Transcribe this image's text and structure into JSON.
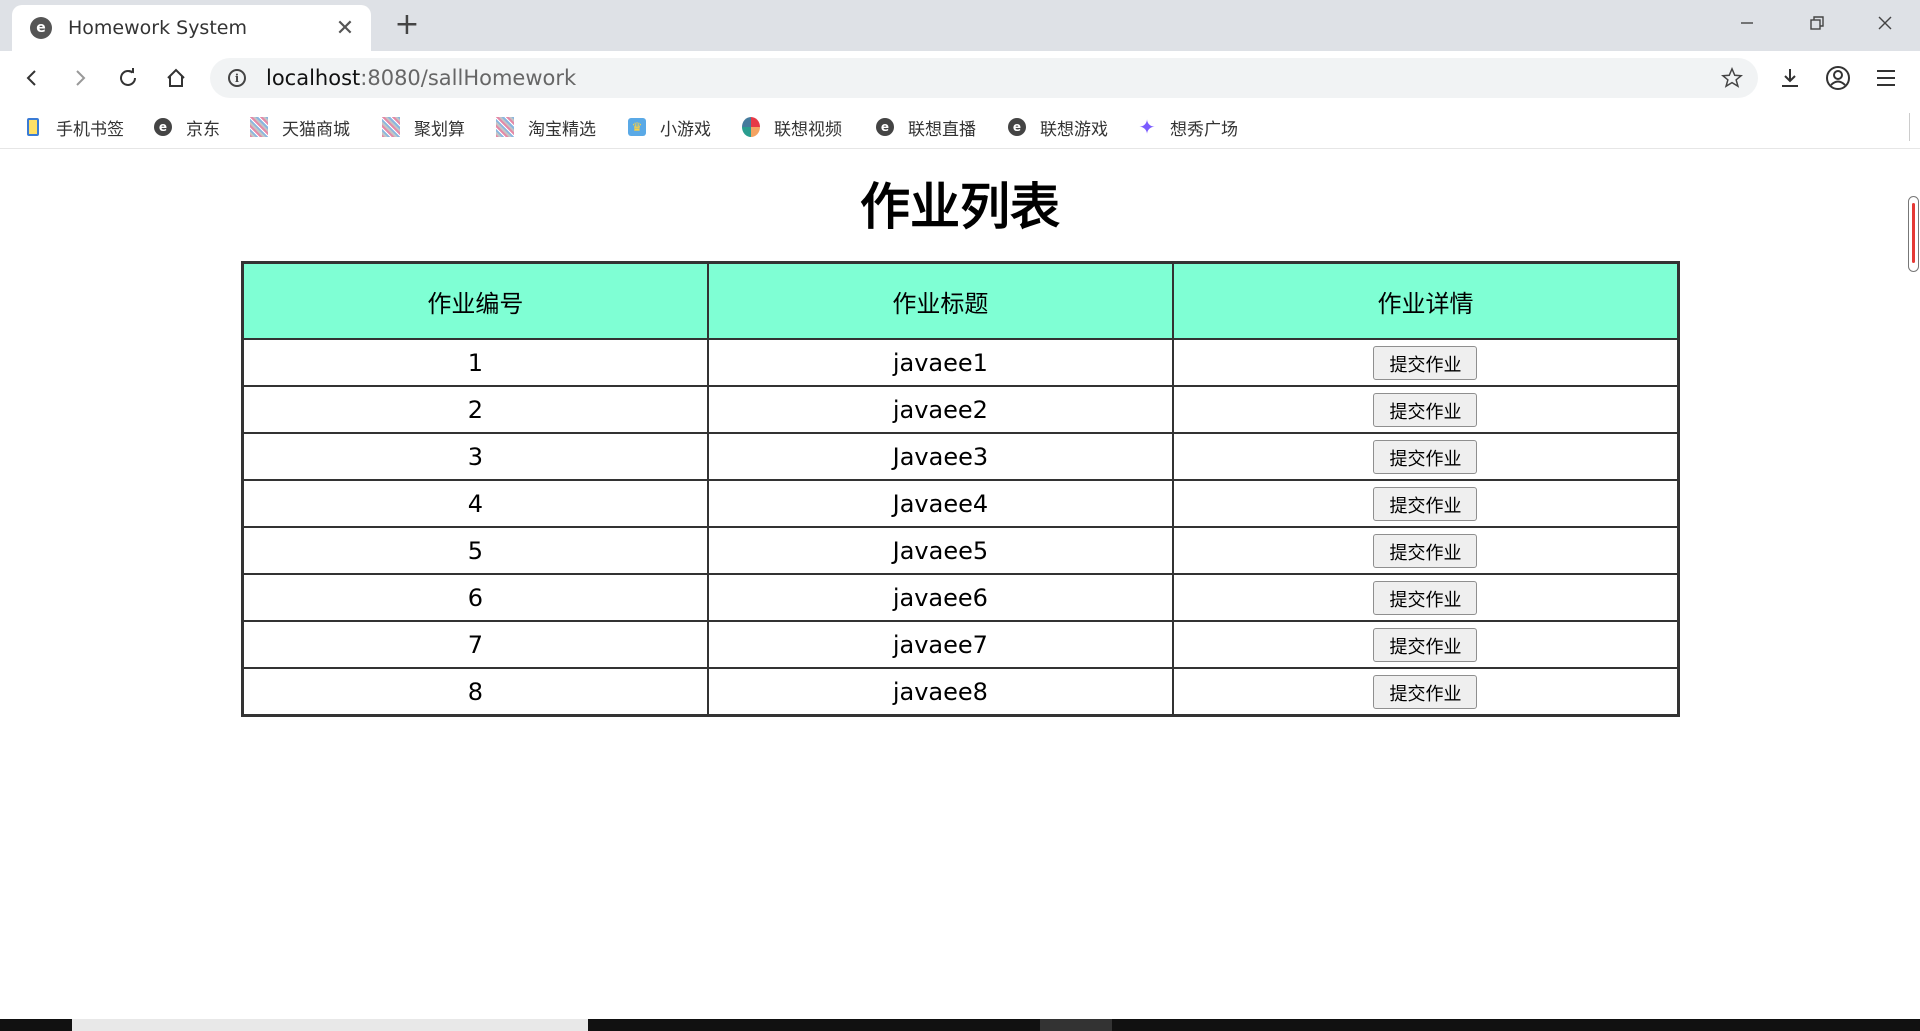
{
  "browser": {
    "tab_title": "Homework System",
    "url_host": "localhost",
    "url_rest": ":8080/sallHomework"
  },
  "bookmarks": [
    {
      "label": "手机书签",
      "icon": "phone-bookmark-icon"
    },
    {
      "label": "京东",
      "icon": "e-browser-icon"
    },
    {
      "label": "天猫商城",
      "icon": "tmall-icon"
    },
    {
      "label": "聚划算",
      "icon": "juhuasuan-icon"
    },
    {
      "label": "淘宝精选",
      "icon": "taobao-icon"
    },
    {
      "label": "小游戏",
      "icon": "game-icon"
    },
    {
      "label": "联想视频",
      "icon": "video-icon"
    },
    {
      "label": "联想直播",
      "icon": "e-browser-icon"
    },
    {
      "label": "联想游戏",
      "icon": "e-browser-icon"
    },
    {
      "label": "想秀广场",
      "icon": "star-icon"
    }
  ],
  "page": {
    "title": "作业列表",
    "headers": [
      "作业编号",
      "作业标题",
      "作业详情"
    ],
    "button_label": "提交作业",
    "rows": [
      {
        "id": "1",
        "title": "javaee1"
      },
      {
        "id": "2",
        "title": "javaee2"
      },
      {
        "id": "3",
        "title": "Javaee3"
      },
      {
        "id": "4",
        "title": "Javaee4"
      },
      {
        "id": "5",
        "title": "Javaee5"
      },
      {
        "id": "6",
        "title": "javaee6"
      },
      {
        "id": "7",
        "title": "javaee7"
      },
      {
        "id": "8",
        "title": "javaee8"
      }
    ]
  },
  "colors": {
    "table_header": "#7fffd4",
    "table_border": "#333333",
    "tab_strip": "#dee1e6"
  }
}
